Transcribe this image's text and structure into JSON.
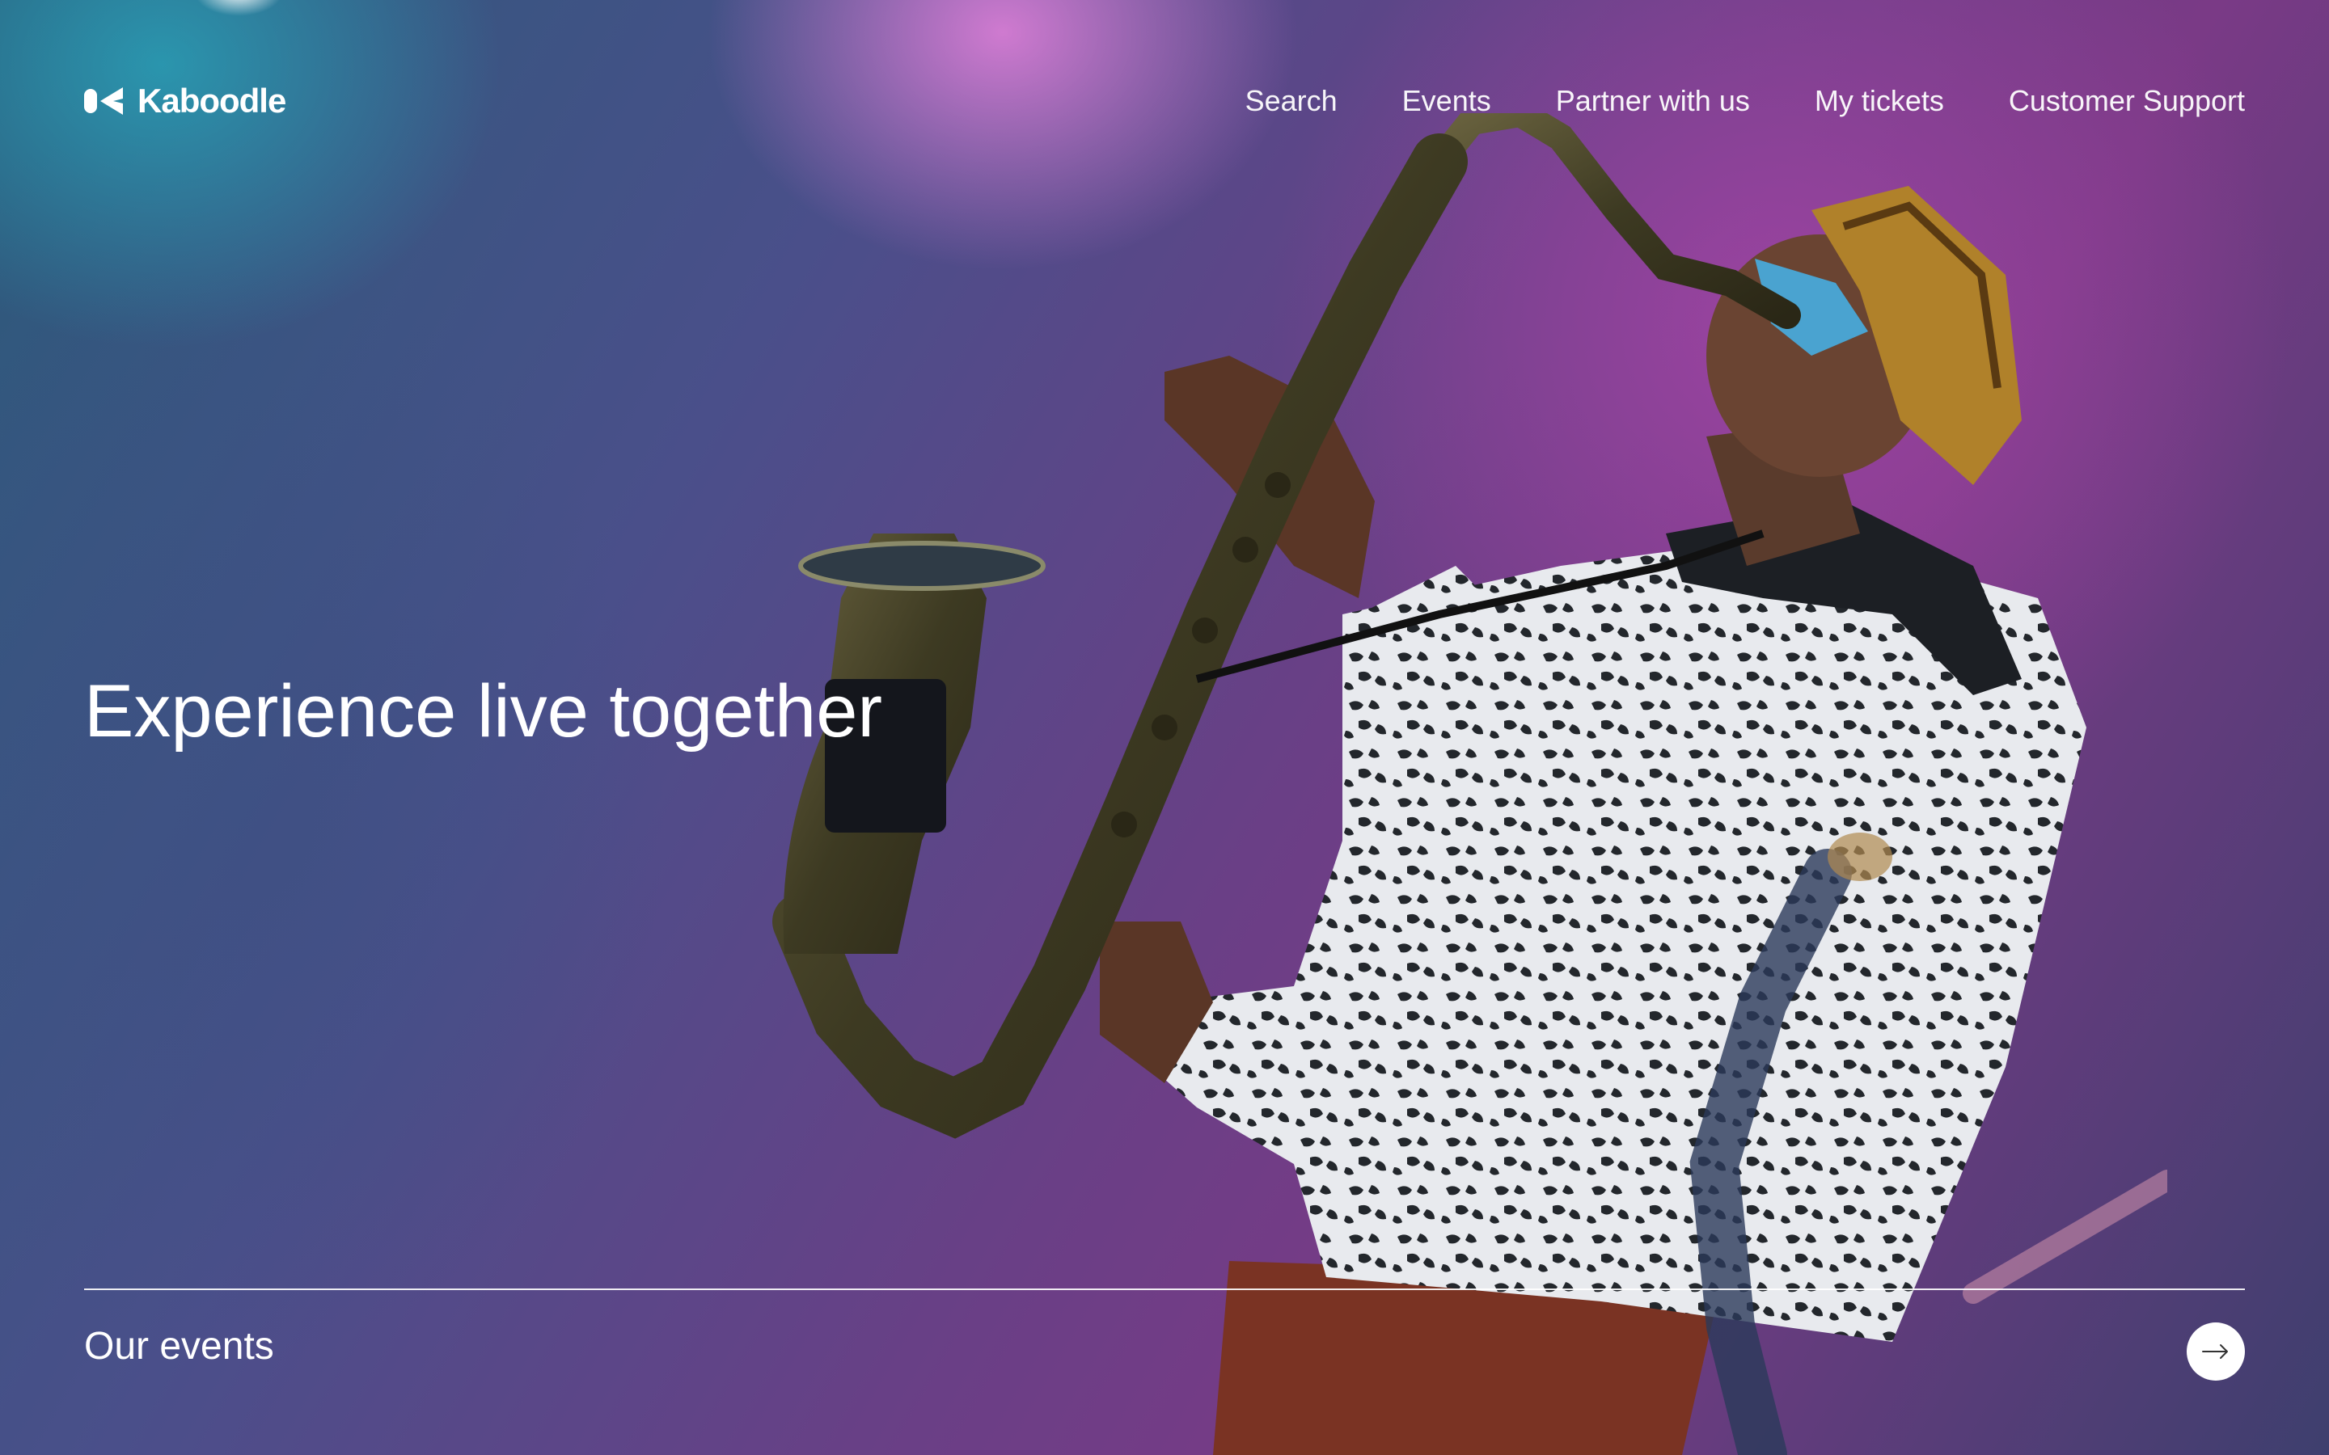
{
  "brand": {
    "name": "Kaboodle",
    "logo_icon": "kaboodle-logo-icon"
  },
  "nav": {
    "items": [
      {
        "label": "Search"
      },
      {
        "label": "Events"
      },
      {
        "label": "Partner with us"
      },
      {
        "label": "My tickets"
      },
      {
        "label": "Customer Support"
      }
    ]
  },
  "hero": {
    "headline": "Experience live together",
    "image": "saxophone-player-photo"
  },
  "footer": {
    "events_label": "Our events",
    "arrow_icon": "arrow-right-icon"
  },
  "colors": {
    "text": "#ffffff",
    "background_teal": "#2b5a7a",
    "background_purple": "#7a3a86",
    "button_bg": "#ffffff"
  }
}
